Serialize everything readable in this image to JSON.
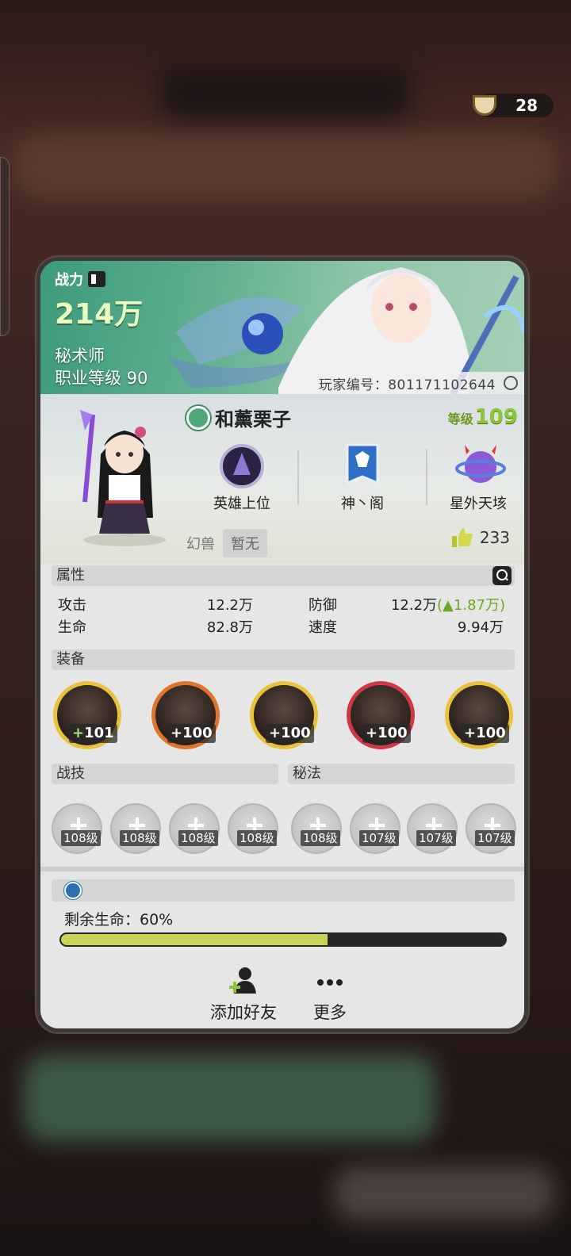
{
  "currency": {
    "icon": "noodle-bowl-icon",
    "amount": "28"
  },
  "banner": {
    "power_label": "战力",
    "power_value": "214万",
    "job_name": "秘术师",
    "job_level": "职业等级 90",
    "player_id": "玩家编号：801171102644"
  },
  "profile": {
    "name": "和薰栗子",
    "level_label": "等级",
    "level_value": "109",
    "badges": [
      {
        "label": "英雄上位",
        "icon": "hero-rank-emblem-icon"
      },
      {
        "label": "神丶阁",
        "icon": "guild-banner-icon"
      },
      {
        "label": "星外天垓",
        "icon": "planet-icon"
      }
    ],
    "beast_label": "幻兽",
    "beast_value": "暂无",
    "likes": "233"
  },
  "attributes": {
    "title": "属性",
    "attack_label": "攻击",
    "attack_value": "12.2万",
    "defense_label": "防御",
    "defense_value": "12.2万",
    "defense_bonus_open": "(",
    "defense_bonus": "1.87万",
    "defense_bonus_close": ")",
    "hp_label": "生命",
    "hp_value": "82.8万",
    "speed_label": "速度",
    "speed_value": "9.94万"
  },
  "equipment": {
    "title": "装备",
    "items": [
      {
        "plus": "+",
        "level": "101",
        "rarity_color": "#e8c23a"
      },
      {
        "plus": "+",
        "level": "100",
        "rarity_color": "#e0742a"
      },
      {
        "plus": "+",
        "level": "100",
        "rarity_color": "#e8c23a"
      },
      {
        "plus": "+",
        "level": "100",
        "rarity_color": "#d03848"
      },
      {
        "plus": "+",
        "level": "100",
        "rarity_color": "#e8c23a"
      }
    ]
  },
  "skills": {
    "combat_title": "战技",
    "secret_title": "秘法",
    "levels": [
      "108级",
      "108级",
      "108级",
      "108级",
      "108级",
      "107级",
      "107级",
      "107级"
    ]
  },
  "status": {
    "hp_label": "剩余生命：60%",
    "hp_percent": 60
  },
  "actions": {
    "add_friend": "添加好友",
    "more": "更多"
  }
}
